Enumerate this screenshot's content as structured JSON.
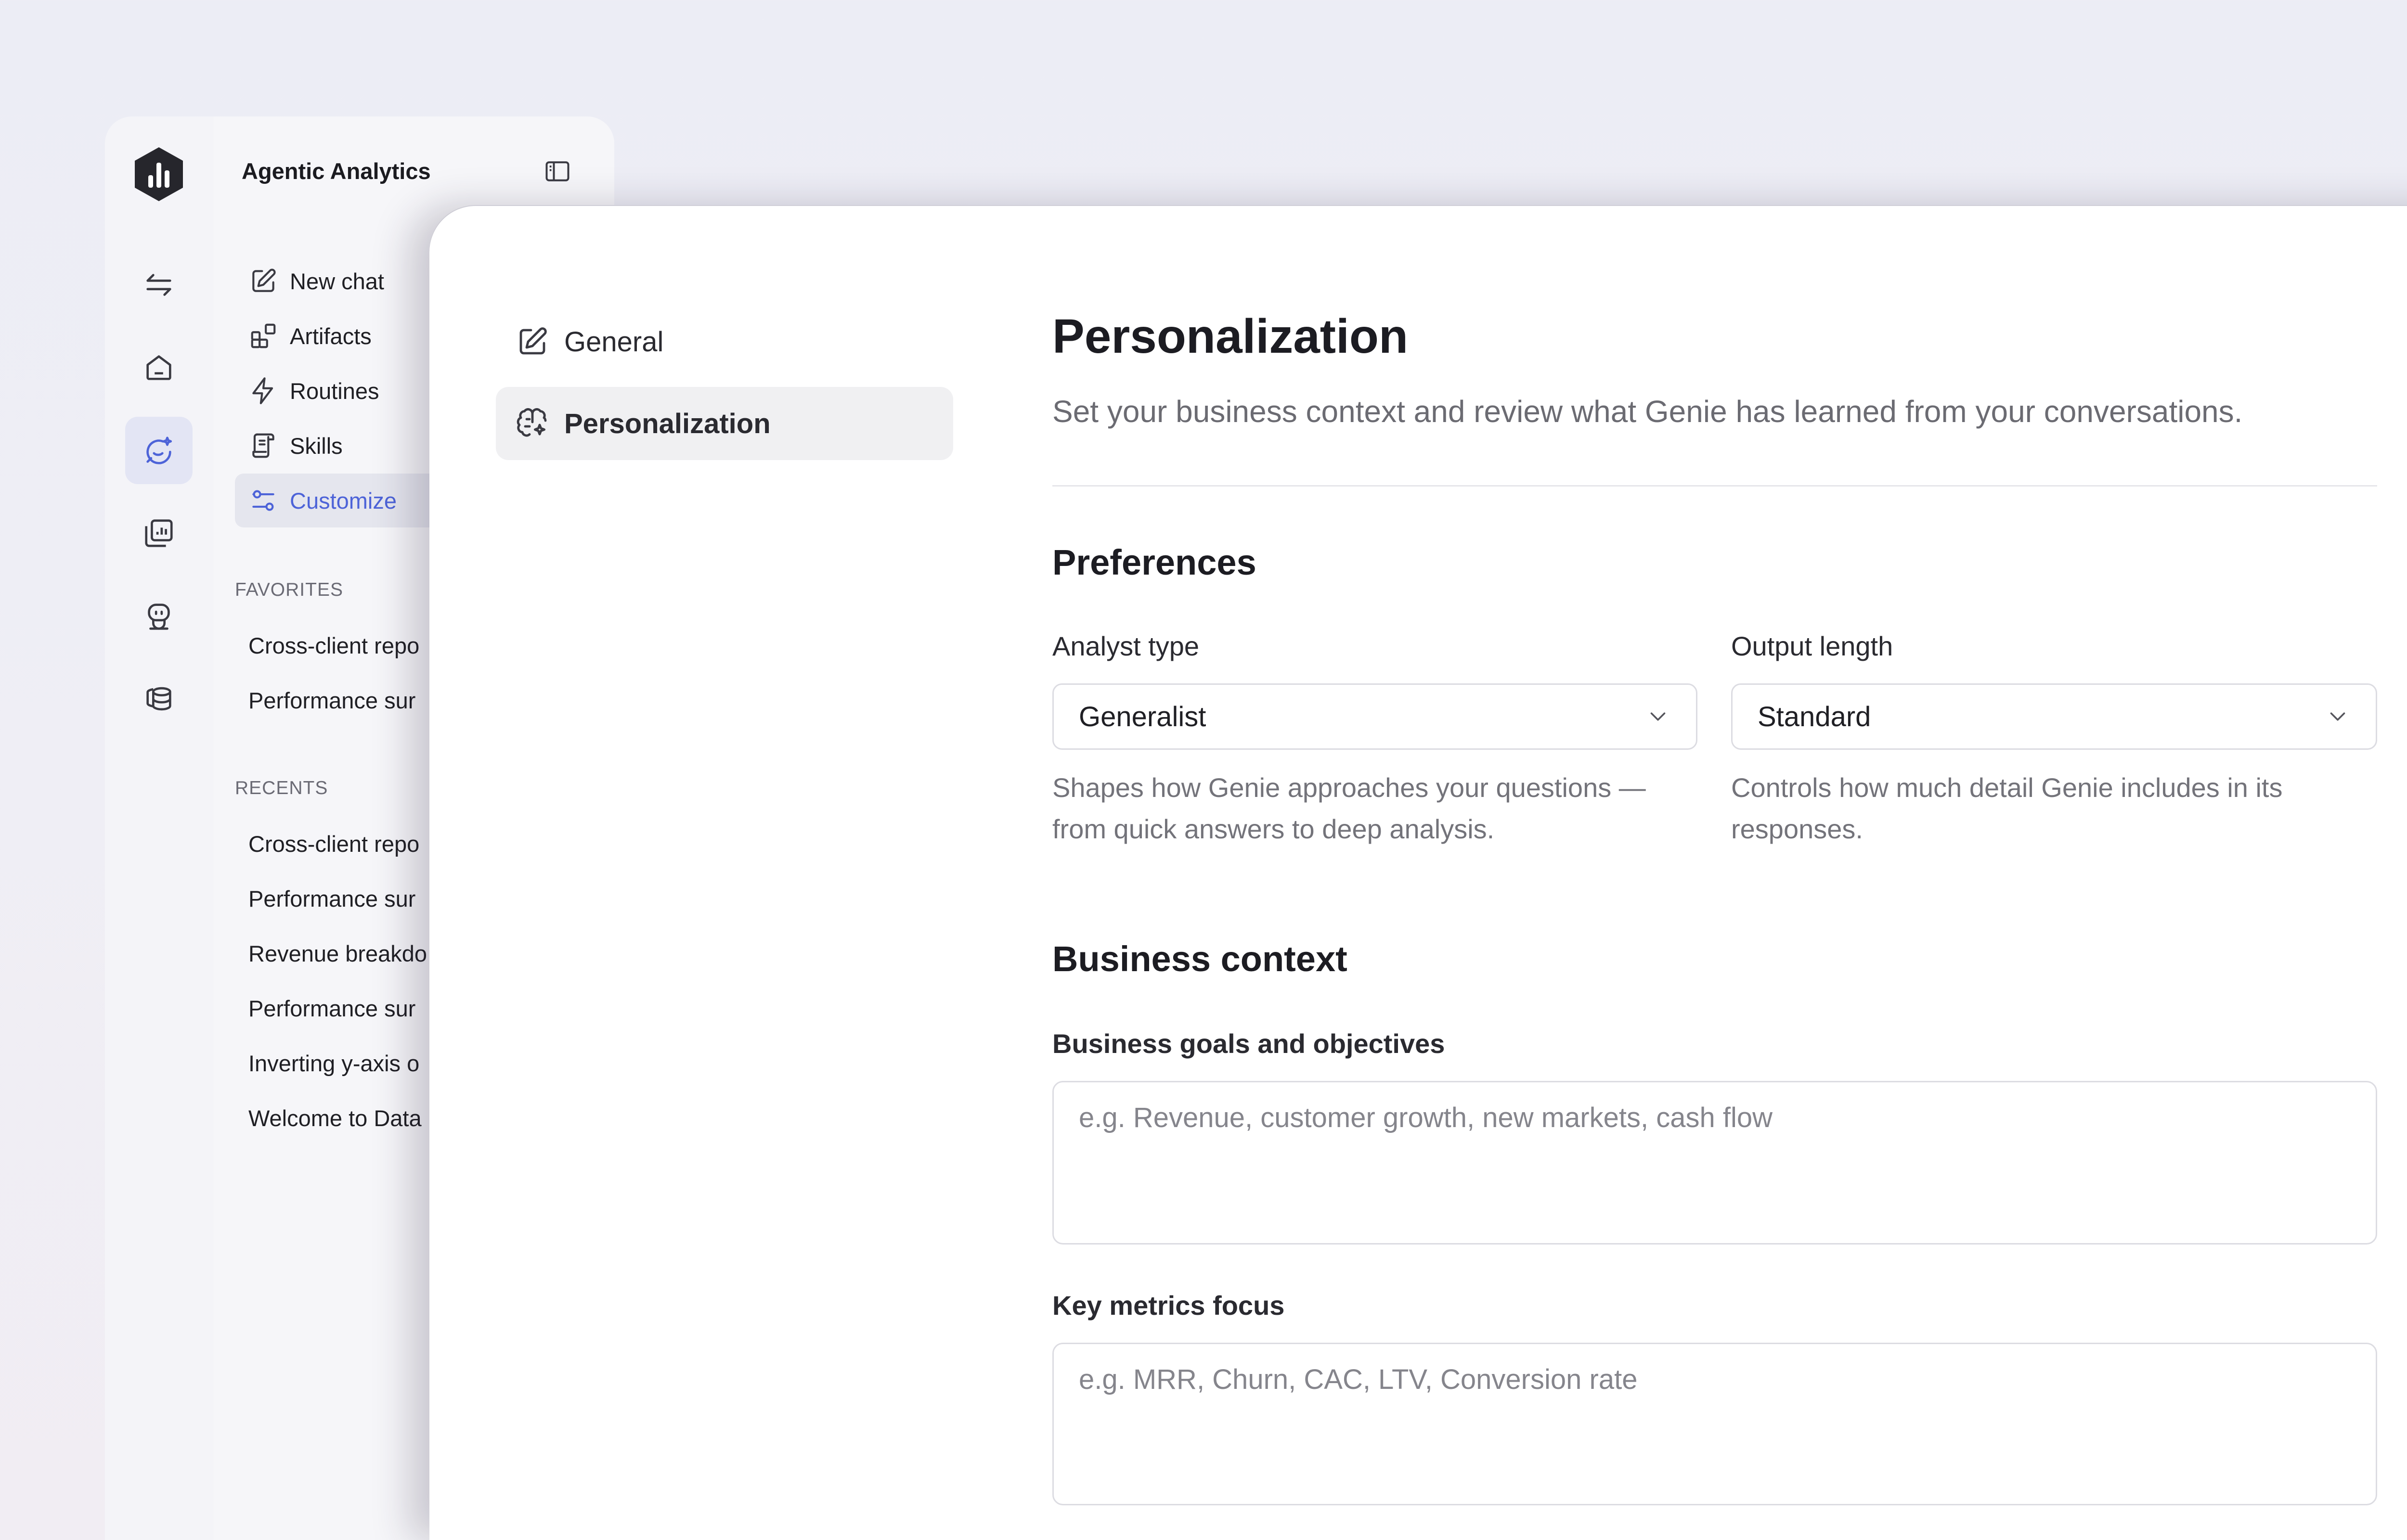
{
  "sidebar": {
    "title": "Agentic Analytics",
    "nav": [
      {
        "label": "New chat",
        "icon": "edit-icon"
      },
      {
        "label": "Artifacts",
        "icon": "artifacts-icon"
      },
      {
        "label": "Routines",
        "icon": "lightning-icon"
      },
      {
        "label": "Skills",
        "icon": "scroll-icon"
      },
      {
        "label": "Customize",
        "icon": "sliders-icon",
        "active": true
      }
    ],
    "favorites_heading": "FAVORITES",
    "favorites": [
      "Cross-client repo",
      "Performance sur"
    ],
    "recents_heading": "RECENTS",
    "recents": [
      "Cross-client repo",
      "Performance sur",
      "Revenue breakdo",
      "Performance sur",
      "Inverting y-axis o",
      "Welcome to Data"
    ]
  },
  "rail": {
    "icons": [
      "logo-icon",
      "switch-arrows-icon",
      "home-icon",
      "genie-chat-icon",
      "dashboards-icon",
      "agent-bot-icon",
      "database-icon"
    ],
    "active": "genie-chat-icon"
  },
  "settings_nav": [
    {
      "label": "General",
      "icon": "edit-icon"
    },
    {
      "label": "Personalization",
      "icon": "brain-sparkle-icon",
      "active": true
    }
  ],
  "main": {
    "title": "Personalization",
    "subtitle": "Set your business context and review what Genie has learned from your conversations.",
    "preferences": {
      "heading": "Preferences",
      "analyst_type": {
        "label": "Analyst type",
        "value": "Generalist",
        "help": "Shapes how Genie approaches your questions — from quick answers to deep analysis."
      },
      "output_length": {
        "label": "Output length",
        "value": "Standard",
        "help": "Controls how much detail Genie includes in its responses."
      }
    },
    "business_context": {
      "heading": "Business context",
      "goals": {
        "label": "Business goals and objectives",
        "placeholder": "e.g. Revenue, customer growth, new markets, cash flow"
      },
      "metrics": {
        "label": "Key metrics focus",
        "placeholder": "e.g. MRR, Churn, CAC, LTV, Conversion rate"
      }
    }
  },
  "colors": {
    "accent": "#4d63d8",
    "active_bg": "#e3e5f4",
    "brand_logo": "#26262c"
  }
}
